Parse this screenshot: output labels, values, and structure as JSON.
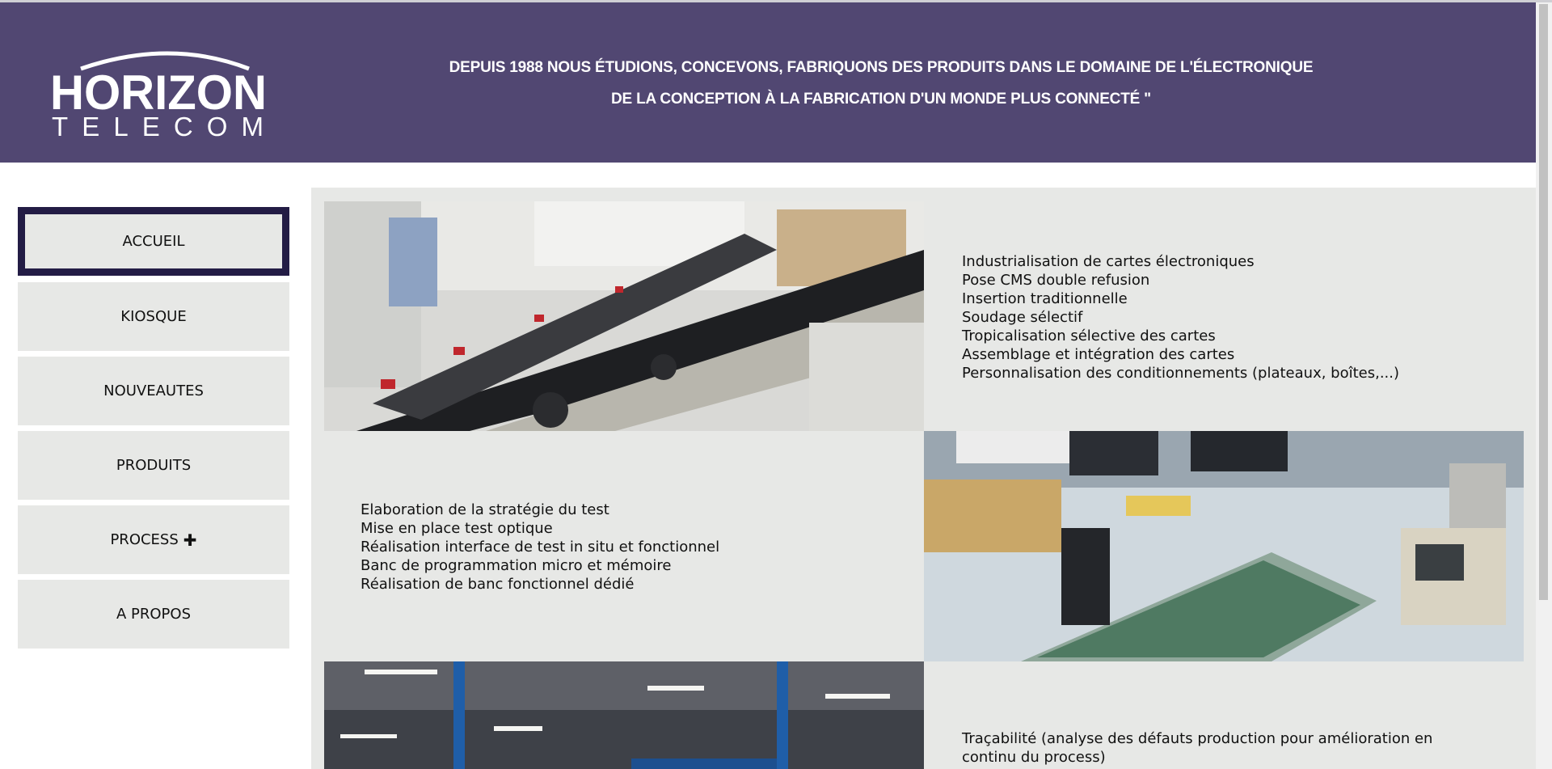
{
  "header": {
    "logo": {
      "line1": "HORIZON",
      "line2": "TELECOM"
    },
    "tagline_line1": "DEPUIS 1988 NOUS ÉTUDIONS, CONCEVONS, FABRIQUONS DES PRODUITS DANS LE DOMAINE DE L'ÉLECTRONIQUE",
    "tagline_line2": "DE LA CONCEPTION À LA FABRICATION D'UN MONDE PLUS CONNECTÉ \"",
    "background": "#514772"
  },
  "nav": {
    "items": [
      {
        "label": "ACCUEIL",
        "active": true
      },
      {
        "label": "KIOSQUE",
        "active": false
      },
      {
        "label": "NOUVEAUTES",
        "active": false
      },
      {
        "label": "PRODUITS",
        "active": false
      },
      {
        "label": "PROCESS",
        "icon": "plus-icon",
        "active": false
      },
      {
        "label": "A PROPOS",
        "active": false
      }
    ],
    "active_border_color": "#231c45"
  },
  "sections": [
    {
      "image": "production-line-photo",
      "lines": [
        "Industrialisation de cartes électroniques",
        "Pose CMS double refusion",
        "Insertion traditionnelle",
        "Soudage sélectif",
        "Tropicalisation sélective des cartes",
        "Assemblage et intégration des cartes",
        "Personnalisation des conditionnements (plateaux, boîtes,...)"
      ]
    },
    {
      "image": "test-bench-photo",
      "lines": [
        "Elaboration de la stratégie du test",
        "Mise en place test optique",
        "Réalisation interface de test in situ et fonctionnel",
        "Banc de programmation micro et mémoire",
        "Réalisation de banc fonctionnel dédié"
      ]
    },
    {
      "image": "warehouse-photo",
      "lines": [
        "Traçabilité (analyse des défauts production pour amélioration en",
        "continu du process)"
      ]
    }
  ]
}
